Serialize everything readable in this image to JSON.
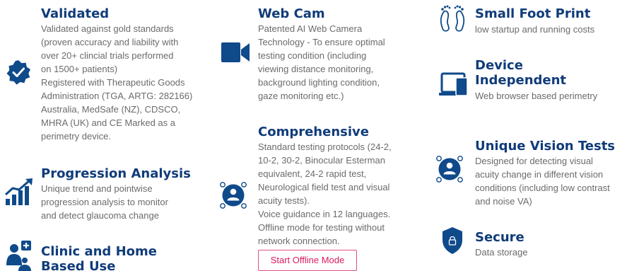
{
  "colors": {
    "heading": "#103c7a",
    "icon": "#0f4a8a",
    "body_text": "#6b6b6b",
    "button_accent": "#d81b60"
  },
  "features": {
    "validated": {
      "title": "Validated",
      "icon": "verified-badge-icon",
      "lines": [
        "Validated against gold standards",
        "(proven accuracy and liability with",
        "over 20+ clincial trials performed",
        "on 1500+ patients)",
        "Registered with Therapeutic Goods",
        "Administration (TGA, ARTG: 282166)",
        "Australia, MedSafe (NZ), CDSCO,",
        "MHRA (UK) and CE Marked as a",
        "perimetry device."
      ]
    },
    "progression": {
      "title": "Progression Analysis",
      "icon": "trend-chart-icon",
      "lines": [
        "Unique trend and pointwise",
        "progression analysis to monitor",
        "and detect glaucoma change"
      ]
    },
    "clinic_home": {
      "title_line1": "Clinic and Home",
      "title_line2": "Based Use",
      "icon": "doctor-patient-icon"
    },
    "webcam": {
      "title": "Web Cam",
      "icon": "video-camera-icon",
      "lines": [
        "Patented AI Web Camera",
        "Technology - To ensure optimal",
        "testing condition (including",
        "viewing distance monitoring,",
        "background lighting condition,",
        "gaze monitoring etc.)"
      ]
    },
    "comprehensive": {
      "title": "Comprehensive",
      "icon": "user-focus-icon",
      "lines": [
        "Standard testing protocols (24-2,",
        "10-2, 30-2, Binocular Esterman",
        "equivalent, 24-2 rapid test,",
        "Neurological field test and visual",
        "acuity tests).",
        "Voice guidance in 12 languages.",
        "Offline mode for testing without",
        "network connection."
      ],
      "button_label": "Start Offline Mode"
    },
    "footprint": {
      "title": "Small Foot Print",
      "icon": "footprints-icon",
      "lines": [
        "low startup and running costs"
      ]
    },
    "device": {
      "title_line1": "Device",
      "title_line2": "Independent",
      "icon": "laptop-tablet-icon",
      "lines": [
        "Web browser based perimetry"
      ]
    },
    "vision_tests": {
      "title": "Unique Vision Tests",
      "icon": "user-focus-icon",
      "lines": [
        "Designed for detecting visual",
        "acuity change in different vision",
        "conditions (including low contrast",
        "and noise VA)"
      ]
    },
    "secure": {
      "title": "Secure",
      "icon": "shield-lock-icon",
      "lines": [
        "Data storage"
      ]
    }
  }
}
